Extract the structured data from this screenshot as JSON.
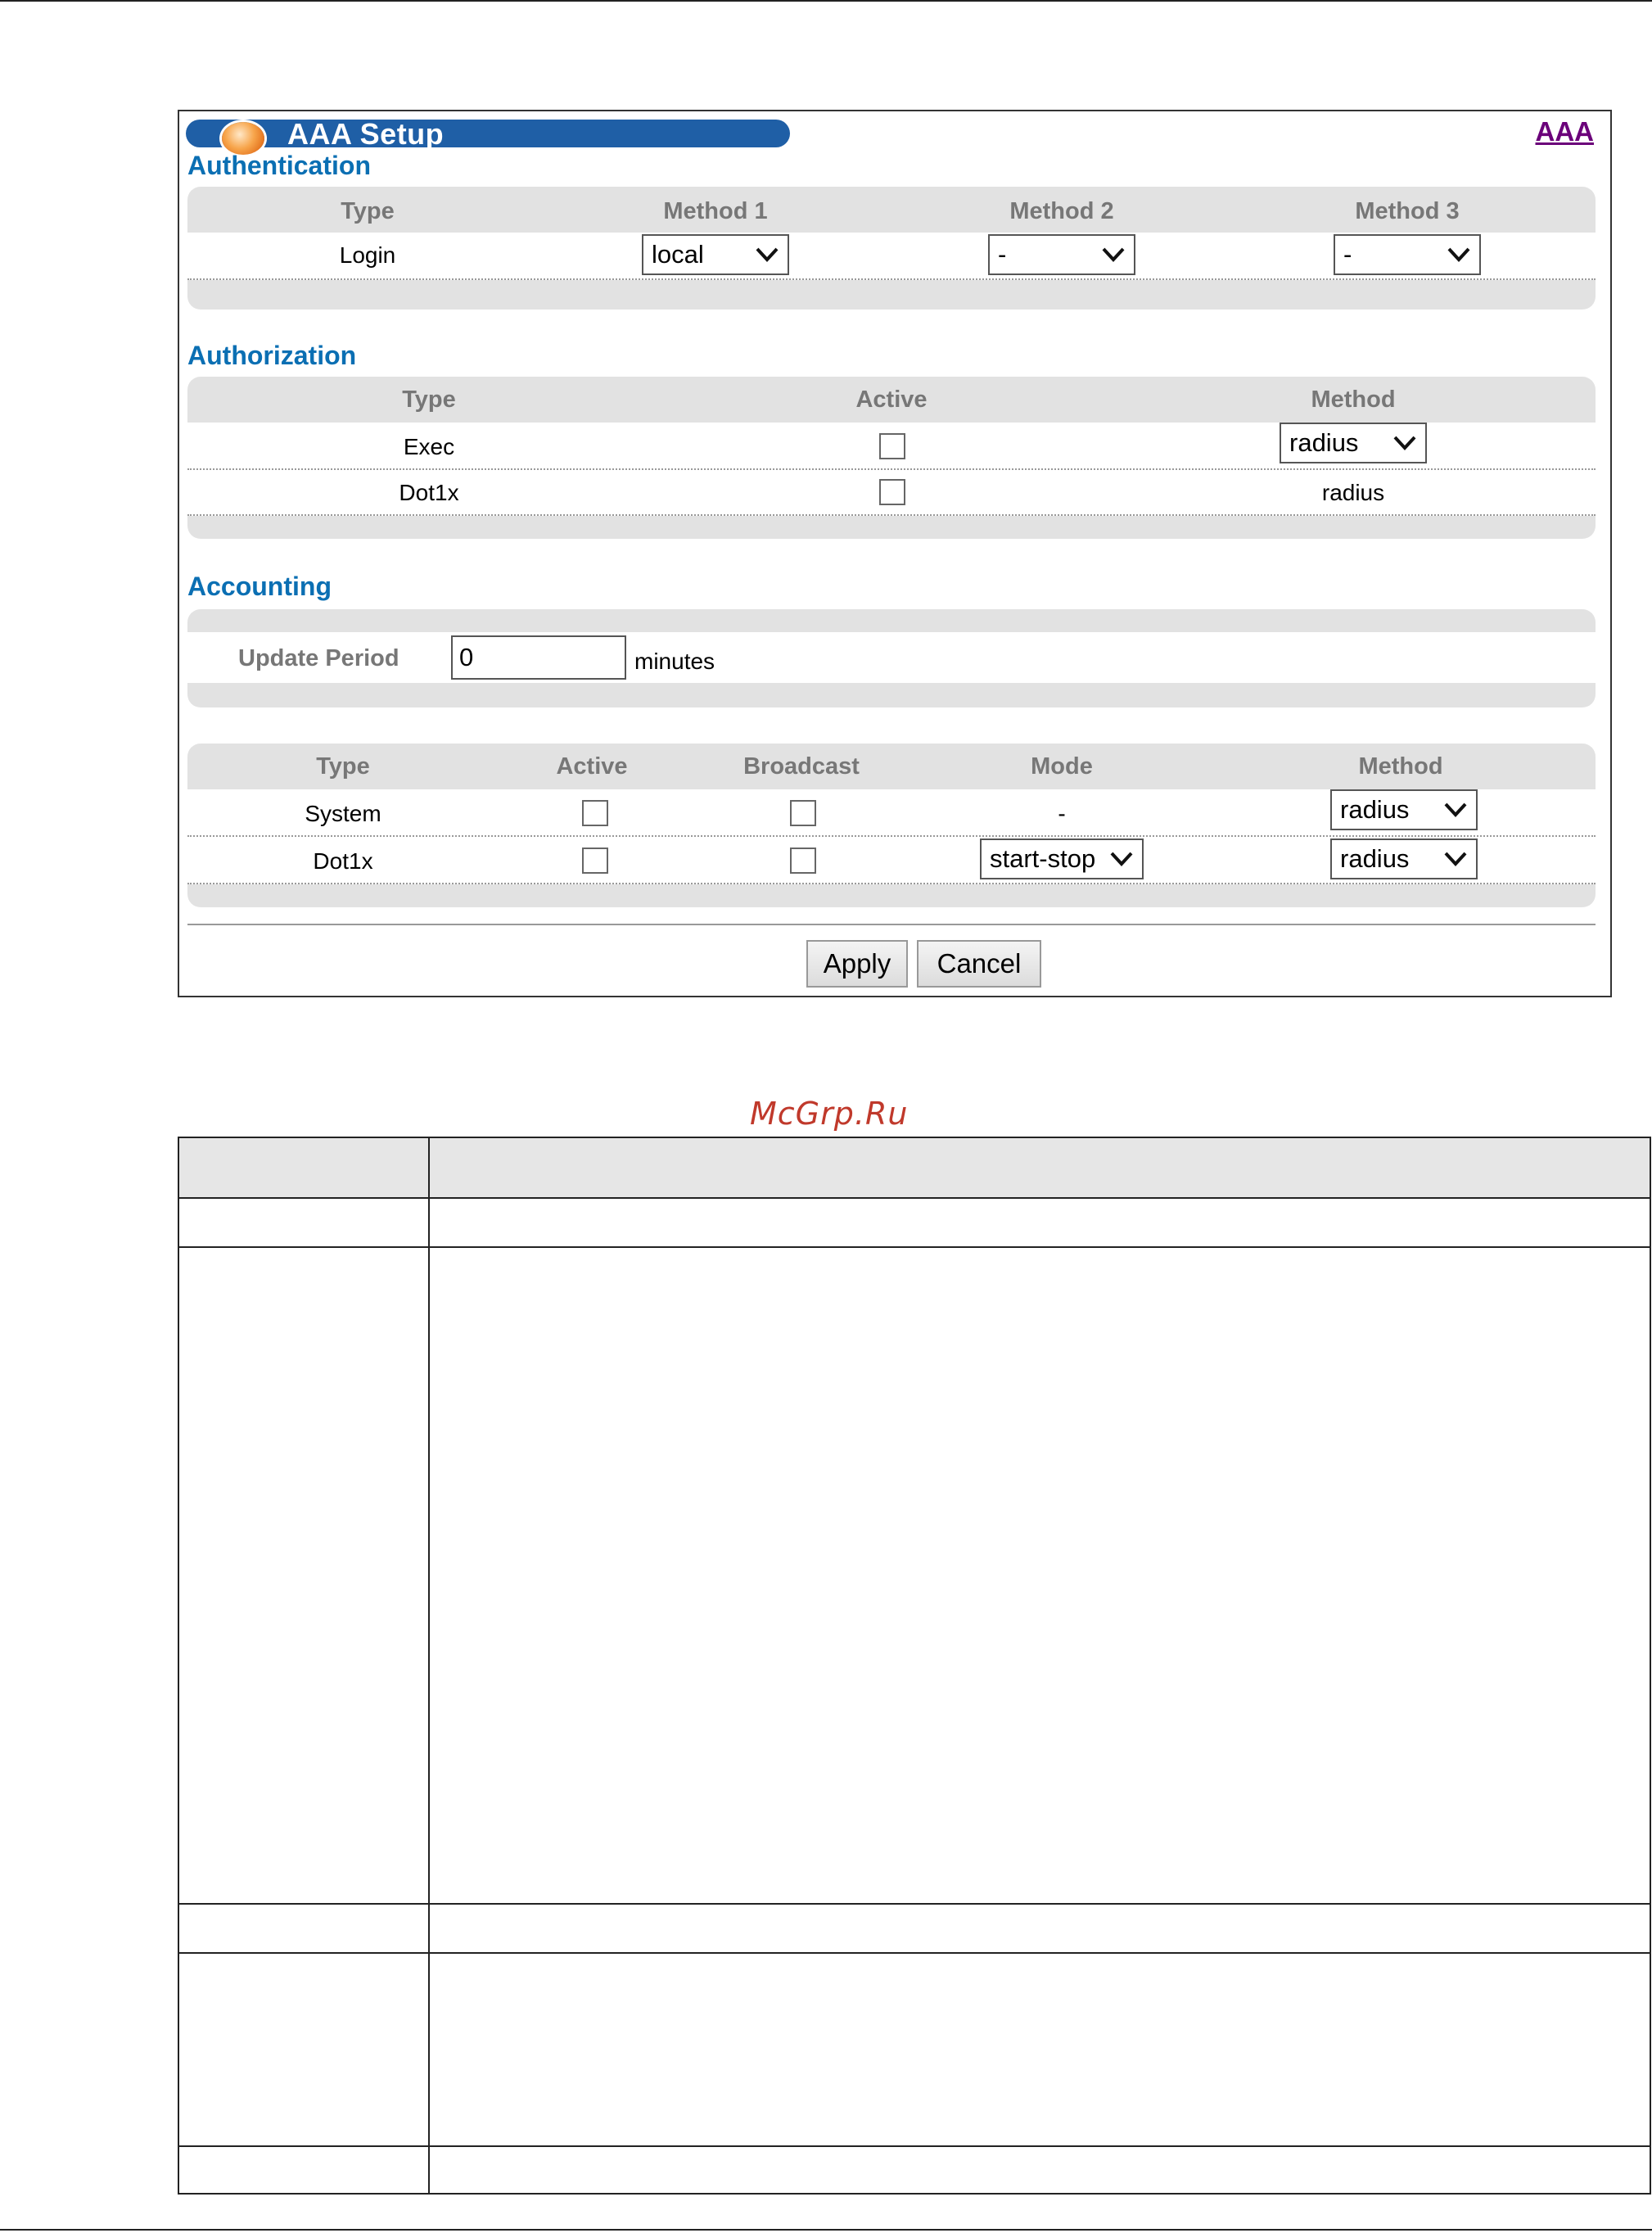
{
  "panel": {
    "title": "AAA Setup",
    "link": "AAA",
    "authentication": {
      "title": "Authentication",
      "headers": [
        "Type",
        "Method 1",
        "Method 2",
        "Method 3"
      ],
      "rows": [
        {
          "type": "Login",
          "method1": "local",
          "method2": "-",
          "method3": "-"
        }
      ]
    },
    "authorization": {
      "title": "Authorization",
      "headers": [
        "Type",
        "Active",
        "Method"
      ],
      "rows": [
        {
          "type": "Exec",
          "active": false,
          "method": "radius",
          "method_is_select": true
        },
        {
          "type": "Dot1x",
          "active": false,
          "method": "radius",
          "method_is_select": false
        }
      ]
    },
    "accounting": {
      "title": "Accounting",
      "update_period_label": "Update Period",
      "update_period_value": "0",
      "update_period_unit": "minutes",
      "headers": [
        "Type",
        "Active",
        "Broadcast",
        "Mode",
        "Method"
      ],
      "rows": [
        {
          "type": "System",
          "active": false,
          "broadcast": false,
          "mode": "-",
          "method": "radius"
        },
        {
          "type": "Dot1x",
          "active": false,
          "broadcast": false,
          "mode": "start-stop",
          "method": "radius"
        }
      ]
    },
    "buttons": {
      "apply": "Apply",
      "cancel": "Cancel"
    }
  },
  "watermark": "McGrp.Ru"
}
